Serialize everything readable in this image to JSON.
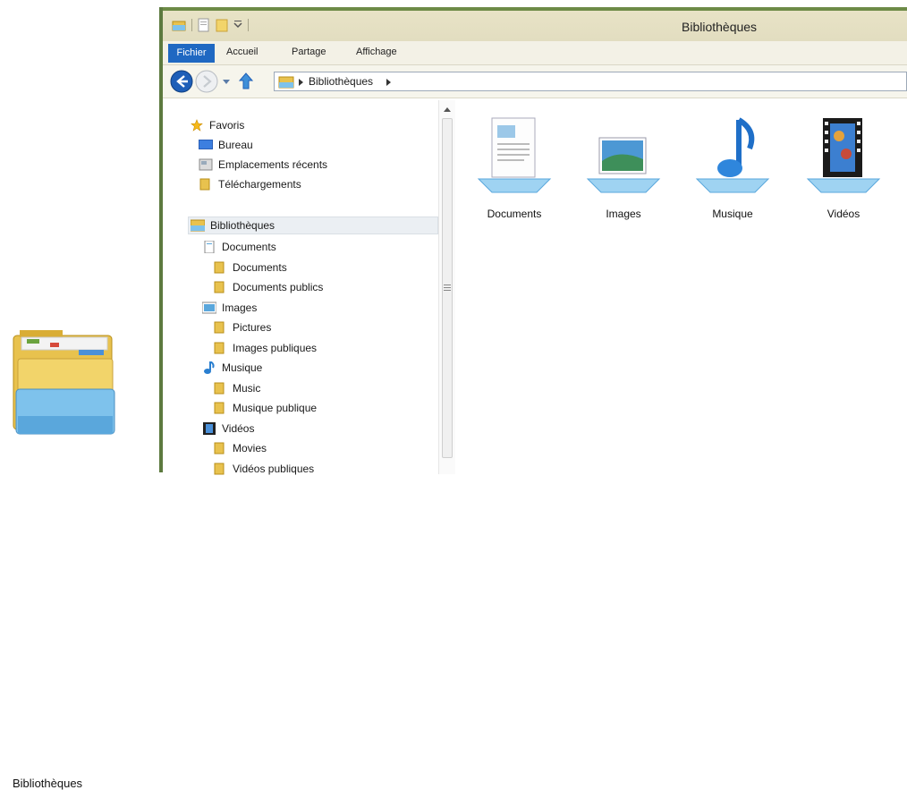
{
  "desktop": {
    "icon_label": "Bibliothèques",
    "icon": "libraries-folder-icon"
  },
  "window": {
    "title": "Bibliothèques",
    "tabs": {
      "file": "Fichier",
      "home": "Accueil",
      "share": "Partage",
      "view": "Affichage"
    },
    "address": {
      "segments": [
        "Bibliothèques"
      ]
    },
    "nav": {
      "favorites": {
        "label": "Favoris",
        "items": [
          {
            "label": "Bureau",
            "icon": "desktop-icon"
          },
          {
            "label": "Emplacements récents",
            "icon": "recent-places-icon"
          },
          {
            "label": "Téléchargements",
            "icon": "downloads-folder-icon"
          }
        ]
      },
      "libraries": {
        "label": "Bibliothèques",
        "groups": [
          {
            "label": "Documents",
            "icon": "documents-icon",
            "children": [
              "Documents",
              "Documents publics"
            ]
          },
          {
            "label": "Images",
            "icon": "images-icon",
            "children": [
              "Pictures",
              "Images publiques"
            ]
          },
          {
            "label": "Musique",
            "icon": "music-icon",
            "children": [
              "Music",
              "Musique publique"
            ]
          },
          {
            "label": "Vidéos",
            "icon": "videos-icon",
            "children": [
              "Movies",
              "Vidéos publiques"
            ]
          }
        ]
      }
    },
    "content": {
      "libraries": [
        {
          "label": "Documents",
          "icon": "documents-library-icon"
        },
        {
          "label": "Images",
          "icon": "images-library-icon"
        },
        {
          "label": "Musique",
          "icon": "music-library-icon"
        },
        {
          "label": "Vidéos",
          "icon": "videos-library-icon"
        }
      ]
    }
  },
  "colors": {
    "title_bar": "#e6e1c4",
    "window_border": "#5d7a3f",
    "file_tab": "#1f68c2",
    "selection": "#ebeff3"
  }
}
